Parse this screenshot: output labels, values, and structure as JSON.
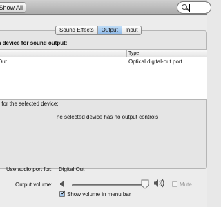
{
  "toolbar": {
    "show_all_label": "Show All",
    "search_value": "",
    "search_icon": "search-icon"
  },
  "tabs": [
    {
      "label": "Sound Effects",
      "selected": false
    },
    {
      "label": "Output",
      "selected": true
    },
    {
      "label": "Input",
      "selected": false
    }
  ],
  "output": {
    "prompt": "a device for sound output:",
    "table": {
      "columns": [
        "",
        "Type"
      ],
      "rows": [
        {
          "name": "Out",
          "type": "Optical digital-out port"
        }
      ]
    },
    "settings_label": "s for the selected device:",
    "no_controls_message": "The selected device has no output controls",
    "port_label": "Use audio port for:",
    "port_value": "Digital Out",
    "volume_label": "Output volume:",
    "volume_fraction": 0.95,
    "mute_label": "Mute",
    "mute_checked": false,
    "show_menu_label": "Show volume in menu bar",
    "show_menu_checked": true
  },
  "colors": {
    "selected_tab": "#8eb9e8",
    "disabled_text": "#9b9b9b"
  }
}
